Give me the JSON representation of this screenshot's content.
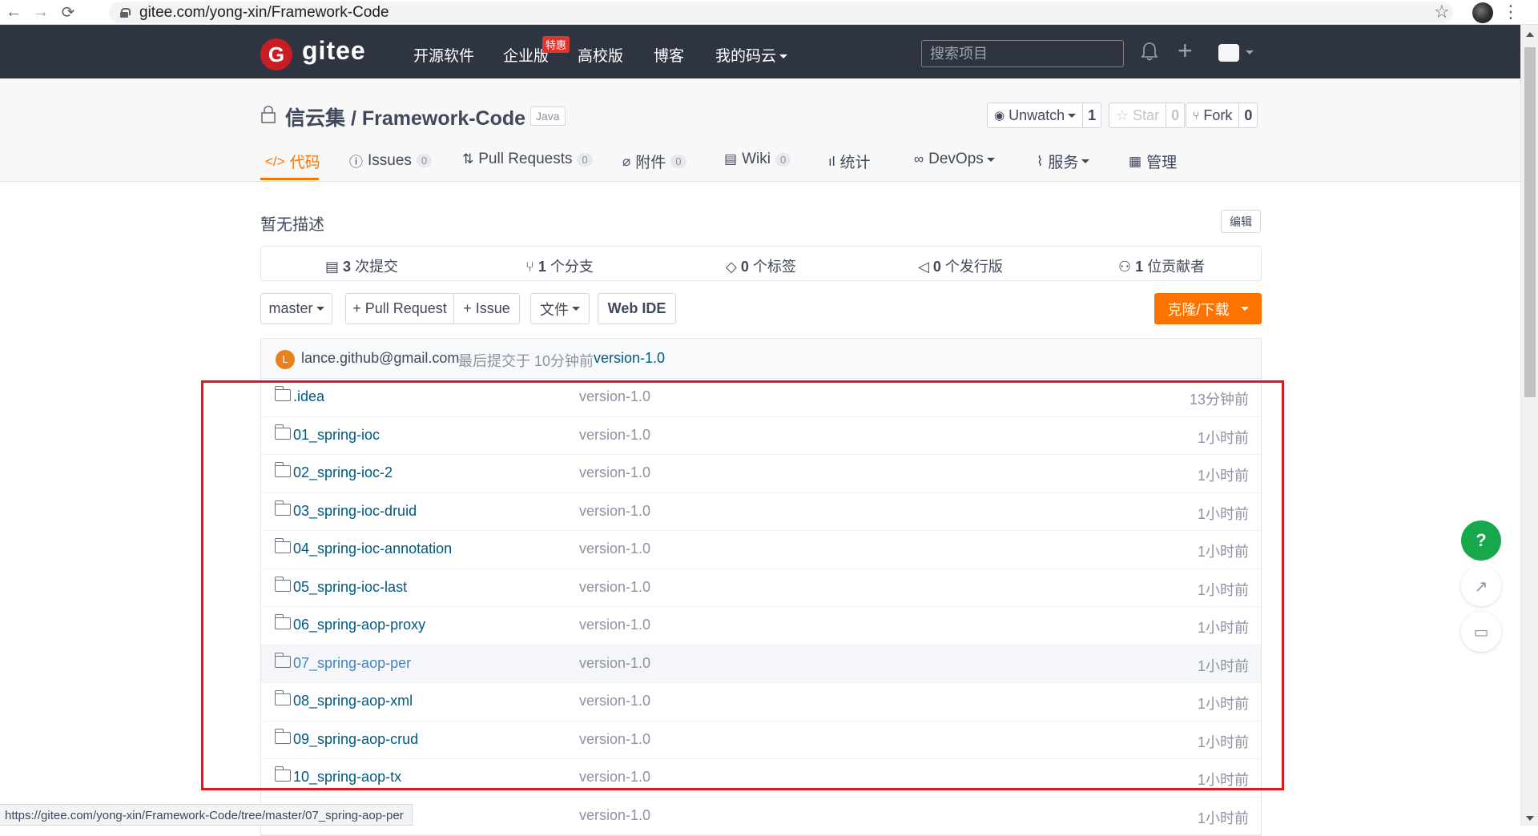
{
  "browser": {
    "url": "gitee.com/yong-xin/Framework-Code",
    "status_url": "https://gitee.com/yong-xin/Framework-Code/tree/master/07_spring-aop-per"
  },
  "header": {
    "logo_mark": "G",
    "logo_text": "gitee",
    "nav": [
      "开源软件",
      "企业版",
      "高校版",
      "博客",
      "我的码云"
    ],
    "badge": "特惠",
    "search_placeholder": "搜索项目"
  },
  "repo": {
    "title": "信云集 / Framework-Code",
    "language": "Java",
    "watch": {
      "label": "Unwatch",
      "count": "1"
    },
    "star": {
      "label": "Star",
      "count": "0"
    },
    "fork": {
      "label": "Fork",
      "count": "0"
    }
  },
  "tabs": [
    {
      "label": "代码",
      "icon": "code-icon"
    },
    {
      "label": "Issues",
      "count": "0",
      "icon": "issue-icon"
    },
    {
      "label": "Pull Requests",
      "count": "0",
      "icon": "pr-icon"
    },
    {
      "label": "附件",
      "count": "0",
      "icon": "attachment-icon"
    },
    {
      "label": "Wiki",
      "count": "0",
      "icon": "wiki-icon"
    },
    {
      "label": "统计",
      "icon": "stats-icon"
    },
    {
      "label": "DevOps",
      "icon": "devops-icon"
    },
    {
      "label": "服务",
      "icon": "service-icon"
    },
    {
      "label": "管理",
      "icon": "manage-icon"
    }
  ],
  "main": {
    "description": "暂无描述",
    "edit_label": "编辑",
    "stats": [
      {
        "num": "3",
        "label": "次提交"
      },
      {
        "num": "1",
        "label": "个分支"
      },
      {
        "num": "0",
        "label": "个标签"
      },
      {
        "num": "0",
        "label": "个发行版"
      },
      {
        "num": "1",
        "label": "位贡献者"
      }
    ],
    "branch": "master",
    "pull_request": "+ Pull Request",
    "issue": "+ Issue",
    "files_menu": "文件",
    "web_ide": "Web IDE",
    "clone": "克隆/下载"
  },
  "commit": {
    "avatar_letter": "L",
    "author": "lance.github@gmail.com",
    "meta": "最后提交于 10分钟前",
    "message": "version-1.0"
  },
  "files": [
    {
      "name": ".idea",
      "commit": "version-1.0",
      "time": "13分钟前"
    },
    {
      "name": "01_spring-ioc",
      "commit": "version-1.0",
      "time": "1小时前"
    },
    {
      "name": "02_spring-ioc-2",
      "commit": "version-1.0",
      "time": "1小时前"
    },
    {
      "name": "03_spring-ioc-druid",
      "commit": "version-1.0",
      "time": "1小时前"
    },
    {
      "name": "04_spring-ioc-annotation",
      "commit": "version-1.0",
      "time": "1小时前"
    },
    {
      "name": "05_spring-ioc-last",
      "commit": "version-1.0",
      "time": "1小时前"
    },
    {
      "name": "06_spring-aop-proxy",
      "commit": "version-1.0",
      "time": "1小时前"
    },
    {
      "name": "07_spring-aop-per",
      "commit": "version-1.0",
      "time": "1小时前"
    },
    {
      "name": "08_spring-aop-xml",
      "commit": "version-1.0",
      "time": "1小时前"
    },
    {
      "name": "09_spring-aop-crud",
      "commit": "version-1.0",
      "time": "1小时前"
    },
    {
      "name": "10_spring-aop-tx",
      "commit": "version-1.0",
      "time": "1小时前"
    },
    {
      "name": "",
      "commit": "version-1.0",
      "time": "1小时前"
    }
  ],
  "float": {
    "help": "?"
  },
  "colors": {
    "brand": "#c71d23",
    "accent": "#fe7300",
    "header_bg": "#2e3440",
    "highlight": "#e8141b",
    "help": "#16a84a"
  }
}
